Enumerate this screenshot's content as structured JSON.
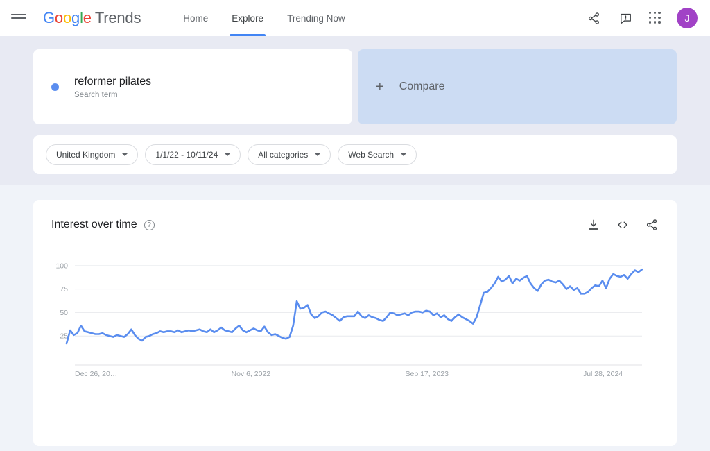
{
  "header": {
    "menu_icon": "hamburger-icon",
    "brand": {
      "google": "Google",
      "product": "Trends"
    },
    "tabs": [
      {
        "label": "Home",
        "active": false
      },
      {
        "label": "Explore",
        "active": true
      },
      {
        "label": "Trending Now",
        "active": false
      }
    ],
    "share_icon": "share-icon",
    "feedback_icon": "feedback-icon",
    "apps_icon": "apps-grid-icon",
    "avatar_initial": "J",
    "avatar_color": "#a142c6",
    "accent_color": "#4285f4"
  },
  "query": {
    "term": "reformer pilates",
    "type_label": "Search term",
    "dot_color": "#5a8def",
    "compare_label": "Compare",
    "compare_plus": "+"
  },
  "filters": [
    {
      "label": "United Kingdom",
      "name": "location"
    },
    {
      "label": "1/1/22 - 10/11/24",
      "name": "date-range"
    },
    {
      "label": "All categories",
      "name": "category"
    },
    {
      "label": "Web Search",
      "name": "search-type"
    }
  ],
  "chart_panel": {
    "title": "Interest over time",
    "help_icon": "help-circle-icon",
    "download_icon": "download-icon",
    "embed_icon": "embed-code-icon",
    "share_icon": "share-icon"
  },
  "chart_data": {
    "type": "line",
    "title": "Interest over time",
    "xlabel": "",
    "ylabel": "",
    "ylim": [
      0,
      108
    ],
    "yticks": [
      25,
      50,
      75,
      100
    ],
    "ytick_labels": [
      "25",
      "50",
      "75",
      "100"
    ],
    "grid": true,
    "legend": false,
    "line_color": "#5a8def",
    "series_name": "reformer pilates",
    "xtick_labels": [
      "Dec 26, 20…",
      "Nov 6, 2022",
      "Sep 17, 2023",
      "Jul 28, 2024"
    ],
    "xtick_positions": [
      0,
      0.3103,
      0.6207,
      0.931
    ],
    "values": [
      17,
      31,
      26,
      28,
      36,
      30,
      29,
      28,
      27,
      27,
      28,
      26,
      25,
      24,
      26,
      25,
      24,
      27,
      32,
      26,
      22,
      20,
      24,
      25,
      27,
      28,
      30,
      29,
      30,
      30,
      29,
      31,
      29,
      30,
      31,
      30,
      31,
      32,
      30,
      29,
      32,
      29,
      31,
      34,
      31,
      30,
      29,
      33,
      36,
      31,
      29,
      31,
      33,
      31,
      30,
      35,
      29,
      26,
      27,
      25,
      23,
      22,
      24,
      36,
      62,
      54,
      55,
      58,
      48,
      44,
      46,
      50,
      51,
      49,
      47,
      44,
      41,
      45,
      46,
      46,
      46,
      51,
      46,
      44,
      47,
      45,
      44,
      42,
      41,
      45,
      50,
      49,
      47,
      48,
      49,
      47,
      50,
      51,
      51,
      50,
      52,
      51,
      47,
      49,
      45,
      47,
      43,
      41,
      45,
      48,
      45,
      43,
      41,
      38,
      45,
      58,
      71,
      72,
      76,
      81,
      88,
      83,
      85,
      89,
      81,
      86,
      84,
      87,
      89,
      81,
      76,
      73,
      80,
      84,
      85,
      83,
      82,
      84,
      80,
      75,
      78,
      74,
      76,
      70,
      70,
      72,
      76,
      79,
      78,
      84,
      76,
      86,
      91,
      89,
      88,
      90,
      86,
      91,
      95,
      93,
      96
    ]
  }
}
